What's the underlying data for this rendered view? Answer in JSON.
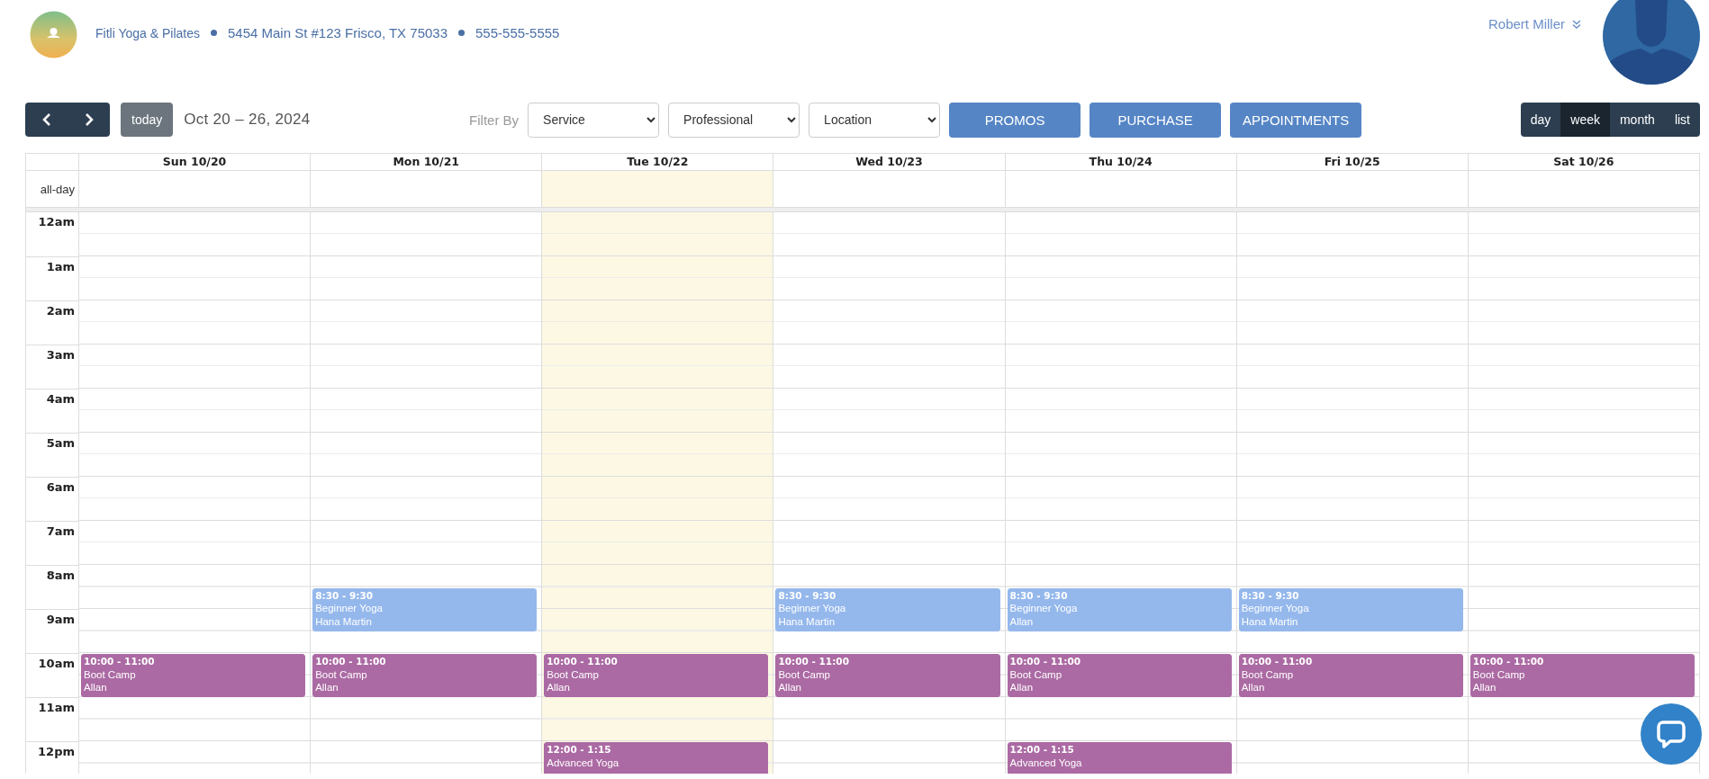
{
  "header": {
    "business_name": "Fitli Yoga & Pilates",
    "address": "5454 Main St #123 Frisco, TX 75033",
    "phone": "555-555-5555",
    "user_name": "Robert Miller"
  },
  "toolbar": {
    "today_button": "today",
    "date_range": "Oct 20 – 26, 2024",
    "filter_label": "Filter By",
    "filters": [
      {
        "value": "Service"
      },
      {
        "value": "Professional"
      },
      {
        "value": "Location"
      }
    ],
    "action_buttons": [
      "PROMOS",
      "PURCHASE",
      "APPOINTMENTS"
    ],
    "views": [
      {
        "label": "day",
        "selected": false
      },
      {
        "label": "week",
        "selected": true
      },
      {
        "label": "month",
        "selected": false
      },
      {
        "label": "list",
        "selected": false
      }
    ]
  },
  "calendar": {
    "all_day_label": "all-day",
    "hours": [
      "12am",
      "1am",
      "2am",
      "3am",
      "4am",
      "5am",
      "6am",
      "7am",
      "8am",
      "9am",
      "10am",
      "11am",
      "12pm"
    ],
    "days": [
      {
        "label": "Sun 10/20",
        "today": false,
        "events": [
          {
            "time": "10:00 - 11:00",
            "title": "Boot Camp",
            "person": "Allan",
            "color": "#ab6aa3"
          }
        ]
      },
      {
        "label": "Mon 10/21",
        "today": false,
        "events": [
          {
            "time": "8:30 - 9:30",
            "title": "Beginner Yoga",
            "person": "Hana Martin",
            "color": "#95b8ec"
          },
          {
            "time": "10:00 - 11:00",
            "title": "Boot Camp",
            "person": "Allan",
            "color": "#ab6aa3"
          }
        ]
      },
      {
        "label": "Tue 10/22",
        "today": true,
        "events": [
          {
            "time": "10:00 - 11:00",
            "title": "Boot Camp",
            "person": "Allan",
            "color": "#ab6aa3"
          },
          {
            "time": "12:00 - 1:15",
            "title": "Advanced Yoga",
            "color": "#ab6aa3"
          }
        ]
      },
      {
        "label": "Wed 10/23",
        "today": false,
        "events": [
          {
            "time": "8:30 - 9:30",
            "title": "Beginner Yoga",
            "person": "Hana Martin",
            "color": "#95b8ec"
          },
          {
            "time": "10:00 - 11:00",
            "title": "Boot Camp",
            "person": "Allan",
            "color": "#ab6aa3"
          }
        ]
      },
      {
        "label": "Thu 10/24",
        "today": false,
        "events": [
          {
            "time": "8:30 - 9:30",
            "title": "Beginner Yoga",
            "person": "Allan",
            "color": "#95b8ec"
          },
          {
            "time": "10:00 - 11:00",
            "title": "Boot Camp",
            "person": "Allan",
            "color": "#ab6aa3"
          },
          {
            "time": "12:00 - 1:15",
            "title": "Advanced Yoga",
            "color": "#ab6aa3"
          }
        ]
      },
      {
        "label": "Fri 10/25",
        "today": false,
        "events": [
          {
            "time": "8:30 - 9:30",
            "title": "Beginner Yoga",
            "person": "Hana Martin",
            "color": "#95b8ec"
          },
          {
            "time": "10:00 - 11:00",
            "title": "Boot Camp",
            "person": "Allan",
            "color": "#ab6aa3"
          }
        ]
      },
      {
        "label": "Sat 10/26",
        "today": false,
        "events": [
          {
            "time": "10:00 - 11:00",
            "title": "Boot Camp",
            "person": "Allan",
            "color": "#ab6aa3"
          }
        ]
      }
    ]
  }
}
